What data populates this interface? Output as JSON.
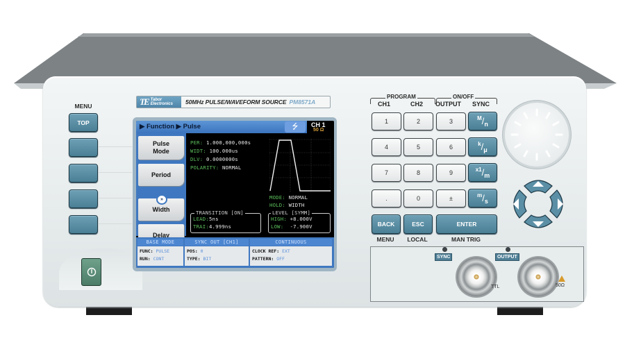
{
  "device": {
    "brand": "Tabor Electronics",
    "brand_line1": "Tabor",
    "brand_line2": "Electronics",
    "brand_mark": "TE",
    "product_title": "50MHz PULSE/WAVEFORM SOURCE",
    "model": "PM8571A"
  },
  "menu_column": {
    "label": "MENU",
    "buttons": [
      {
        "label": "TOP"
      },
      {
        "label": ""
      },
      {
        "label": ""
      },
      {
        "label": ""
      },
      {
        "label": ""
      }
    ],
    "power_icon": "power-icon"
  },
  "screen": {
    "breadcrumb": "▶ Function ▶ Pulse",
    "usb_icon": "usb-icon",
    "channel": "CH 1",
    "impedance": "50 Ω",
    "softkeys": [
      {
        "line1": "Pulse",
        "line2": "Mode"
      },
      {
        "line1": "Period",
        "line2": ""
      },
      {
        "line1": "Width",
        "line2": ""
      },
      {
        "line1": "Delay",
        "line2": ""
      }
    ],
    "scroll_indicator": "»",
    "params": [
      {
        "label": "PER:",
        "value": "1.000,000,000s"
      },
      {
        "label": "WIDT:",
        "value": "100.000us"
      },
      {
        "label": "DLV:",
        "value": "0.0000000s"
      },
      {
        "label": "POLARITY:",
        "value": "NORMAL"
      }
    ],
    "mode": {
      "label": "MODE:",
      "value": "NORMAL"
    },
    "hold": {
      "label": "HOLD:",
      "value": "WIDTH"
    },
    "transition": {
      "title": "TRANSITION [ON]",
      "lead_label": "LEAD:",
      "lead_value": "5ns",
      "trail_label": "TRAI:",
      "trail_value": "4.999ns"
    },
    "level": {
      "title": "LEVEL [SYMM]",
      "high_label": "HIGH:",
      "high_value": "+8.000V",
      "low_label": "LOW:",
      "low_value": "-7.900V"
    },
    "status": [
      {
        "title": "BASE MODE",
        "lines": [
          {
            "k": "FUNC:",
            "v": "PULSE"
          },
          {
            "k": "RUN:",
            "v": "CONT"
          }
        ]
      },
      {
        "title": "SYNC OUT [CH1]",
        "lines": [
          {
            "k": "POS:",
            "v": "0"
          },
          {
            "k": "TYPE:",
            "v": "BIT"
          }
        ]
      },
      {
        "title": "CONTINUOUS",
        "lines": [
          {
            "k": "CLOCK REF:",
            "v": "EXT"
          },
          {
            "k": "PATTERN:",
            "v": "OFF"
          }
        ]
      }
    ]
  },
  "keypad": {
    "program_group": "PROGRAM",
    "onoff_group": "ON/OFF",
    "column_heads": [
      "CH1",
      "CH2",
      "OUTPUT",
      "SYNC"
    ],
    "digits": [
      "1",
      "2",
      "3",
      "4",
      "5",
      "6",
      "7",
      "8",
      "9",
      ".",
      "0",
      "±"
    ],
    "units": [
      {
        "top": "M",
        "bottom": "n"
      },
      {
        "top": "k",
        "bottom": "μ"
      },
      {
        "top": "x1",
        "bottom": "m"
      },
      {
        "top": "m",
        "bottom": "s"
      }
    ],
    "back": "BACK",
    "esc": "ESC",
    "enter": "ENTER",
    "back_sub": "MENU",
    "esc_sub": "LOCAL",
    "enter_sub": "MAN TRIG"
  },
  "connectors": {
    "sync_tag": "SYNC",
    "output_tag": "OUTPUT",
    "ttl_label": "TTL",
    "output_impedance": "50Ω",
    "warning_icon": "warning-icon"
  },
  "colors": {
    "accent_teal": "#5a8ea4",
    "screen_blue": "#3f78c0",
    "param_green": "#5cbf5c",
    "power_green": "#5a8c76"
  }
}
